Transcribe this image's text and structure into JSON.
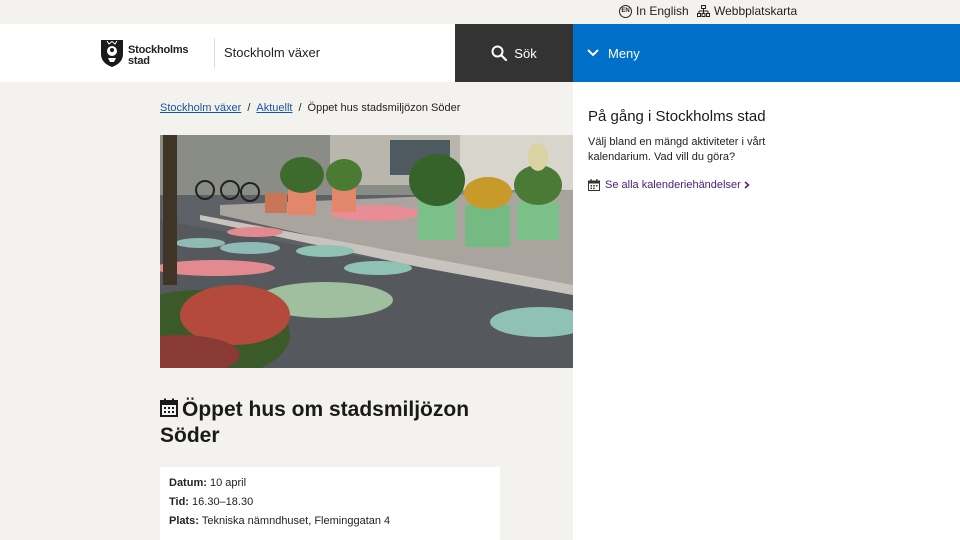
{
  "topbar": {
    "english_label": "In English",
    "english_badge": "EN",
    "sitemap_label": "Webbplatskarta"
  },
  "header": {
    "logo_line1": "Stockholms",
    "logo_line2": "stad",
    "site_name": "Stockholm växer",
    "search_label": "Sök",
    "menu_label": "Meny"
  },
  "breadcrumb": {
    "items": [
      "Stockholm växer",
      "Aktuellt"
    ],
    "current": "Öppet hus stadsmiljözon Söder",
    "separator": "/"
  },
  "article": {
    "title_line1": "Öppet hus om stadsmiljözon",
    "title_line2": "Söder",
    "date_label": "Datum:",
    "date_value": "10 april",
    "time_label": "Tid:",
    "time_value": "16.30–18.30",
    "place_label": "Plats:",
    "place_value": "Tekniska nämndhuset, Fleminggatan 4"
  },
  "aside": {
    "title": "På gång i Stockholms stad",
    "text": "Välj bland en mängd aktiviteter i vårt kalendarium. Vad vill du göra?",
    "link_label": "Se alla kalenderiehändelser"
  },
  "colors": {
    "menu_blue": "#0070c9",
    "search_dark": "#333333",
    "link_blue": "#1657a4",
    "link_purple": "#4b1c7a",
    "page_bg": "#f4f2ee"
  }
}
